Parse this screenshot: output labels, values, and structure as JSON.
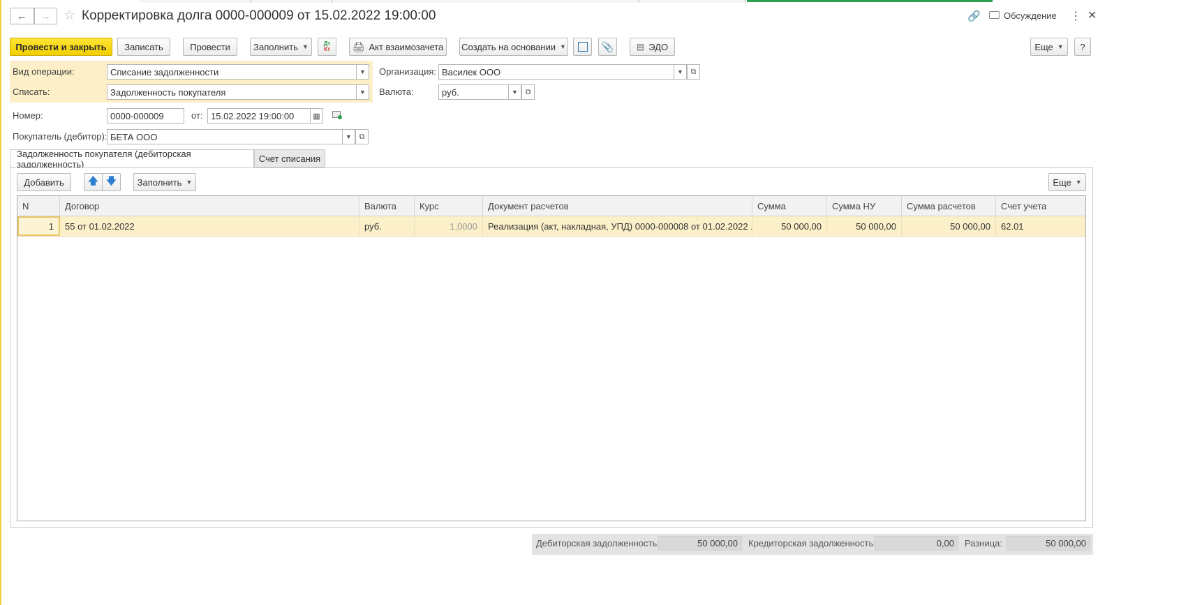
{
  "window": {
    "title": "Корректировка долга 0000-000009 от 15.02.2022 19:00:00",
    "discussion_label": "Обсуждение"
  },
  "toolbar": {
    "post_close_label": "Провести и закрыть",
    "save_label": "Записать",
    "post_label": "Провести",
    "fill_label": "Заполнить",
    "dtkt_label_top": "Дт",
    "dtkt_label_bottom": "Кт",
    "act_label": "Акт взаимозачета",
    "create_based_label": "Создать на основании",
    "edo_label": "ЭДО",
    "more_label": "Еще",
    "help_label": "?"
  },
  "form": {
    "operation_type_label": "Вид операции:",
    "operation_type_value": "Списание задолженности",
    "writeoff_label": "Списать:",
    "writeoff_value": "Задолженность покупателя",
    "org_label": "Организация:",
    "org_value": "Василек ООО",
    "currency_label": "Валюта:",
    "currency_value": "руб.",
    "number_label": "Номер:",
    "number_value": "0000-000009",
    "date_label": "от:",
    "date_value": "15.02.2022 19:00:00",
    "buyer_label": "Покупатель (дебитор):",
    "buyer_value": "БЕТА ООО"
  },
  "tabs": [
    {
      "label": "Задолженность покупателя (дебиторская задолженность)",
      "active": true
    },
    {
      "label": "Счет списания",
      "active": false
    }
  ],
  "table_toolbar": {
    "add_label": "Добавить",
    "fill_label": "Заполнить",
    "more_label": "Еще"
  },
  "table": {
    "columns": [
      "N",
      "Договор",
      "Валюта",
      "Курс",
      "Документ расчетов",
      "Сумма",
      "Сумма НУ",
      "Сумма расчетов",
      "Счет учета"
    ],
    "rows": [
      {
        "n": "1",
        "contract": "55 от 01.02.2022",
        "currency": "руб.",
        "rate": "1,0000",
        "document": "Реализация (акт, накладная, УПД) 0000-000008 от 01.02.2022 ...",
        "sum": "50 000,00",
        "sum_nu": "50 000,00",
        "sum_settle": "50 000,00",
        "account": "62.01"
      }
    ]
  },
  "footer": {
    "debit_label": "Дебиторская задолженность:",
    "debit_value": "50 000,00",
    "credit_label": "Кредиторская задолженность:",
    "credit_value": "0,00",
    "diff_label": "Разница:",
    "diff_value": "50 000,00"
  },
  "colors": {
    "accent_yellow": "#f5d400",
    "highlight_row": "#fcf0c9",
    "header_zone": "#fdefc7",
    "tab_indicator_green": "#2ea04c"
  }
}
